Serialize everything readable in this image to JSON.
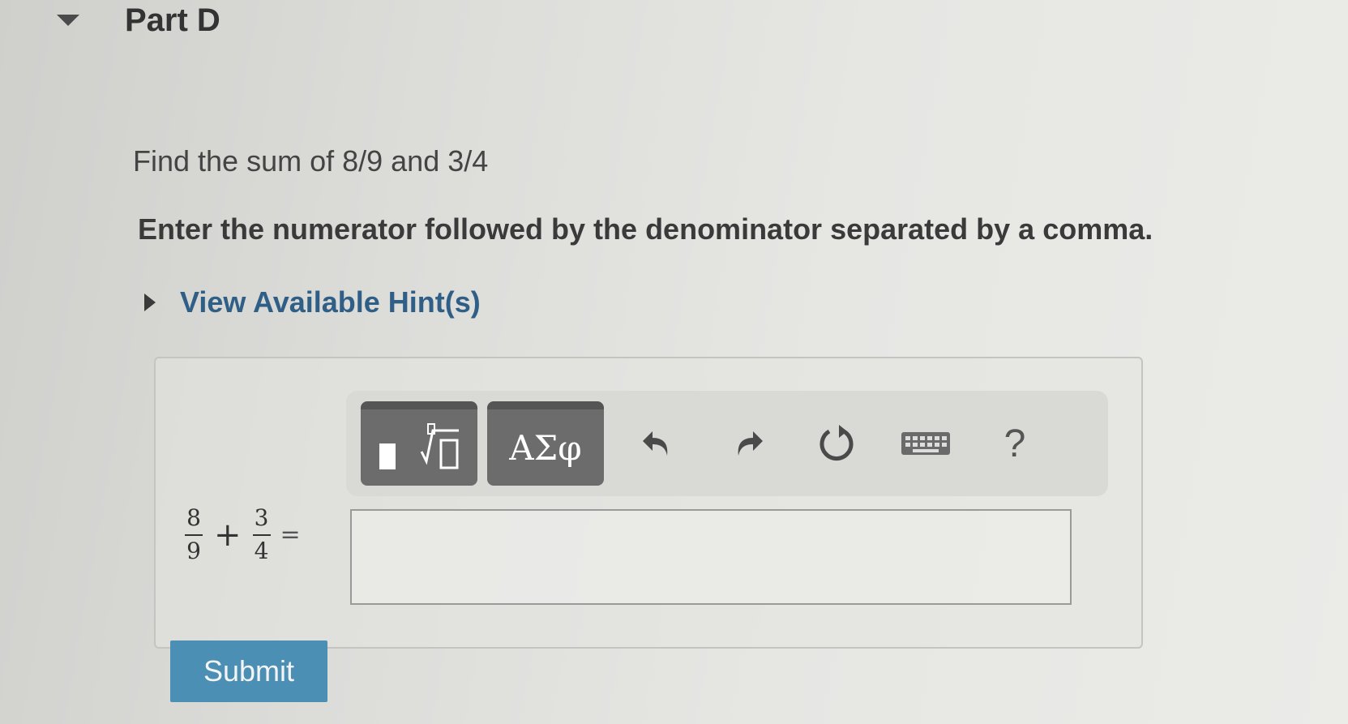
{
  "part": {
    "title": "Part D"
  },
  "question": {
    "prompt": "Find the sum of 8/9 and 3/4",
    "instruction": "Enter the numerator followed by the denominator separated by a comma."
  },
  "hint": {
    "label": "View Available Hint(s)"
  },
  "toolbar": {
    "greek_label": "ΑΣφ",
    "help_label": "?",
    "icons": [
      "templates-icon",
      "greek-symbols-icon",
      "undo-icon",
      "redo-icon",
      "reset-icon",
      "keyboard-icon",
      "help-icon"
    ]
  },
  "equation": {
    "fraction1": {
      "numerator": "8",
      "denominator": "9"
    },
    "operator": "+",
    "fraction2": {
      "numerator": "3",
      "denominator": "4"
    },
    "equals": "="
  },
  "answer": {
    "value": ""
  },
  "submit": {
    "label": "Submit"
  },
  "colors": {
    "hint_link": "#2f5f86",
    "submit_button": "#4c8fb4",
    "tool_button": "#6c6c6c"
  }
}
